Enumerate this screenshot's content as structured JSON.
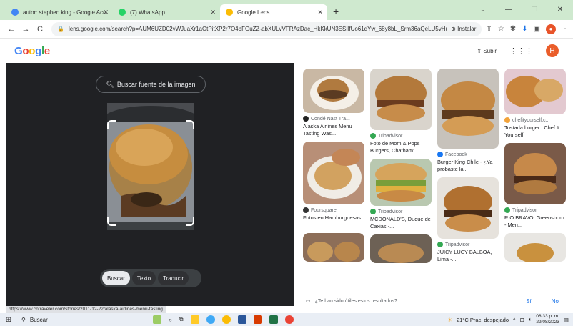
{
  "tabs": [
    {
      "title": "autor: stephen king - Google Acc",
      "icon": "google-icon"
    },
    {
      "title": "(7) WhatsApp",
      "icon": "whatsapp-icon"
    },
    {
      "title": "Google Lens",
      "icon": "lens-icon"
    }
  ],
  "toolbar": {
    "url": "lens.google.com/search?p=AUM6UZD02vWJuaXr1aOtPitXP2r7O4bFGuZZ-abXULvVFRAzDac_HkKkUN3ESiIfUo61dYw_68y8bL_Srm36aQeLU5vHu...",
    "install_label": "Instalar"
  },
  "header": {
    "logo": "Google",
    "upload_label": "Subir",
    "avatar_letter": "H"
  },
  "lens": {
    "find_source_label": "Buscar fuente de la imagen",
    "modes": [
      "Buscar",
      "Texto",
      "Traducir"
    ]
  },
  "results": {
    "col1": [
      {
        "source": "Condé Nast Tra...",
        "title": "Alaska Airlines Menu Tasting Was..."
      },
      {
        "source": "Foursquare",
        "title": "Fotos en Hamburguesas..."
      }
    ],
    "col2": [
      {
        "source": "Tripadvisor",
        "title": "Foto de Mom & Pops Burgers, Chatham:..."
      },
      {
        "source": "Tripadvisor",
        "title": "MCDONALD'S, Duque de Caxias -..."
      }
    ],
    "col3": [
      {
        "source": "Facebook",
        "title": "Burger King Chile - ¿Ya probaste la..."
      },
      {
        "source": "Tripadvisor",
        "title": "JUICY LUCY BALBOA, Lima -..."
      }
    ],
    "col4": [
      {
        "source": "chefityourself.c...",
        "title": "Tostada burger | Chef It Yourself"
      },
      {
        "source": "Tripadvisor",
        "title": "RIO BRAVO, Greensboro - Men..."
      }
    ]
  },
  "feedback": {
    "question": "¿Te han sido útiles estos resultados?",
    "yes": "Sí",
    "no": "No"
  },
  "status_url": "https://www.cntraveler.com/stories/2011-12-22/alaska-airlines-menu-tasting",
  "taskbar": {
    "search_label": "Buscar",
    "weather": "21°C  Prac. despejado",
    "time": "08:33 p. m.",
    "date": "29/08/2023"
  },
  "colors": {
    "tabstrip": "#cfe9cf",
    "lens_panel": "#202124",
    "accent": "#1a73e8"
  }
}
